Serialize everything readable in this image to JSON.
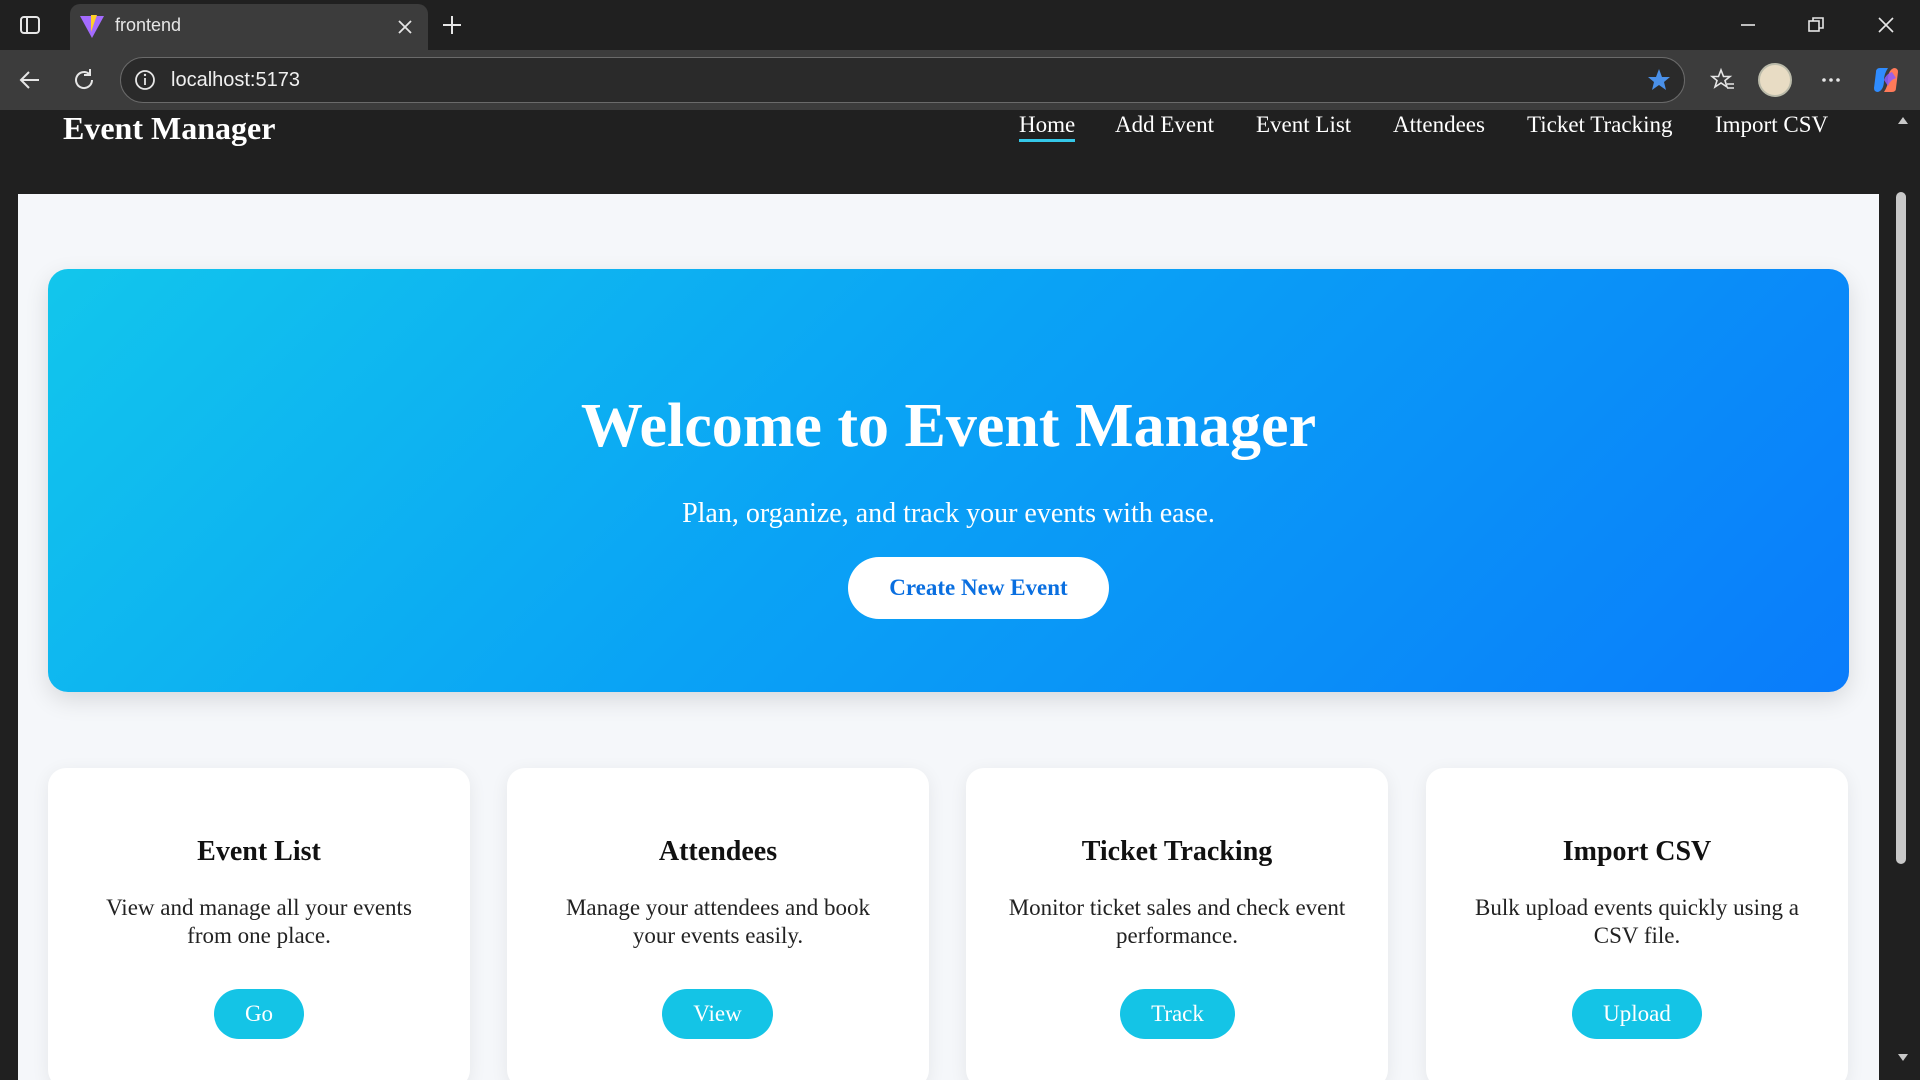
{
  "browser": {
    "tab_title": "frontend",
    "url": "localhost:5173"
  },
  "app": {
    "brand": "Event Manager",
    "nav": [
      "Home",
      "Add Event",
      "Event List",
      "Attendees",
      "Ticket Tracking",
      "Import CSV"
    ],
    "active_nav": "Home"
  },
  "hero": {
    "title": "Welcome to Event Manager",
    "subtitle": "Plan, organize, and track your events with ease.",
    "cta": "Create New Event"
  },
  "cards": [
    {
      "title": "Event List",
      "description": "View and manage all your events from one place.",
      "button": "Go"
    },
    {
      "title": "Attendees",
      "description": "Manage your attendees and book your events easily.",
      "button": "View"
    },
    {
      "title": "Ticket Tracking",
      "description": "Monitor ticket sales and check event performance.",
      "button": "Track"
    },
    {
      "title": "Import CSV",
      "description": "Bulk upload events quickly using a CSV file.",
      "button": "Upload"
    }
  ],
  "colors": {
    "hero_gradient_start": "#12c6ec",
    "hero_gradient_end": "#0a7cfb",
    "card_button": "#14c4e6",
    "navbar": "#202020",
    "active_underline": "#35c8e8"
  }
}
